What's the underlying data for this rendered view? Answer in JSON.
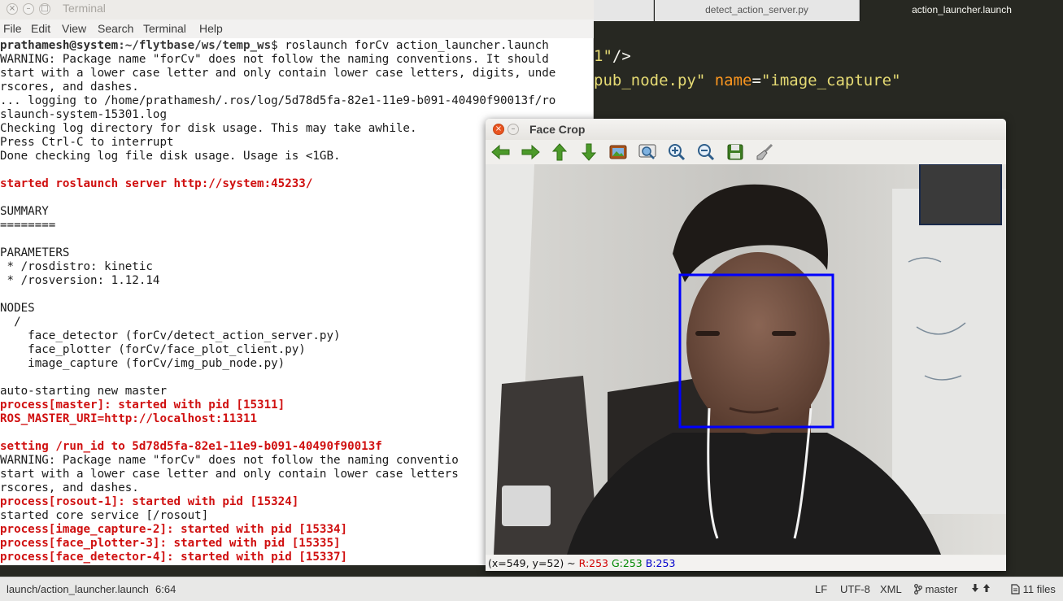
{
  "editor": {
    "tabs": [
      "detect_action_server.py",
      "action_launcher.launch"
    ],
    "active_tab": "action_launcher.launch",
    "code_line_1": {
      "str": "1\"",
      "rest": "/>"
    },
    "code_line_2": {
      "str": "pub_node.py\"",
      "attr": "name",
      "eq": "=",
      "val": "\"image_capture\""
    }
  },
  "terminal": {
    "title": "Terminal",
    "window_buttons": {
      "close": "×",
      "minimize": "–",
      "maximize": "□"
    },
    "menu": [
      "File",
      "Edit",
      "View",
      "Search",
      "Terminal",
      "Help"
    ],
    "prompt_user": "prathamesh@system",
    "prompt_path": ":~/flytbase/ws/temp_ws",
    "prompt_cmd": "$ roslaunch forCv action_launcher.launch",
    "lines": [
      {
        "text": "WARNING: Package name \"forCv\" does not follow the naming conventions. It should",
        "style": "normal"
      },
      {
        "text": "start with a lower case letter and only contain lower case letters, digits, unde",
        "style": "normal"
      },
      {
        "text": "rscores, and dashes.",
        "style": "normal"
      },
      {
        "text": "... logging to /home/prathamesh/.ros/log/5d78d5fa-82e1-11e9-b091-40490f90013f/ro",
        "style": "normal"
      },
      {
        "text": "slaunch-system-15301.log",
        "style": "normal"
      },
      {
        "text": "Checking log directory for disk usage. This may take awhile.",
        "style": "normal"
      },
      {
        "text": "Press Ctrl-C to interrupt",
        "style": "normal"
      },
      {
        "text": "Done checking log file disk usage. Usage is <1GB.",
        "style": "normal"
      },
      {
        "text": "",
        "style": "normal"
      },
      {
        "text": "started roslaunch server http://system:45233/",
        "style": "red"
      },
      {
        "text": "",
        "style": "normal"
      },
      {
        "text": "SUMMARY",
        "style": "normal"
      },
      {
        "text": "========",
        "style": "normal"
      },
      {
        "text": "",
        "style": "normal"
      },
      {
        "text": "PARAMETERS",
        "style": "normal"
      },
      {
        "text": " * /rosdistro: kinetic",
        "style": "normal"
      },
      {
        "text": " * /rosversion: 1.12.14",
        "style": "normal"
      },
      {
        "text": "",
        "style": "normal"
      },
      {
        "text": "NODES",
        "style": "normal"
      },
      {
        "text": "  /",
        "style": "normal"
      },
      {
        "text": "    face_detector (forCv/detect_action_server.py)",
        "style": "normal"
      },
      {
        "text": "    face_plotter (forCv/face_plot_client.py)",
        "style": "normal"
      },
      {
        "text": "    image_capture (forCv/img_pub_node.py)",
        "style": "normal"
      },
      {
        "text": "",
        "style": "normal"
      },
      {
        "text": "auto-starting new master",
        "style": "normal"
      },
      {
        "text": "process[master]: started with pid [15311]",
        "style": "red"
      },
      {
        "text": "ROS_MASTER_URI=http://localhost:11311",
        "style": "red"
      },
      {
        "text": "",
        "style": "normal"
      },
      {
        "text": "setting /run_id to 5d78d5fa-82e1-11e9-b091-40490f90013f",
        "style": "red"
      },
      {
        "text": "WARNING: Package name \"forCv\" does not follow the naming conventio",
        "style": "normal"
      },
      {
        "text": "start with a lower case letter and only contain lower case letters",
        "style": "normal"
      },
      {
        "text": "rscores, and dashes.",
        "style": "normal"
      },
      {
        "text": "process[rosout-1]: started with pid [15324]",
        "style": "red"
      },
      {
        "text": "started core service [/rosout]",
        "style": "normal"
      },
      {
        "text": "process[image_capture-2]: started with pid [15334]",
        "style": "red"
      },
      {
        "text": "process[face_plotter-3]: started with pid [15335]",
        "style": "red"
      },
      {
        "text": "process[face_detector-4]: started with pid [15337]",
        "style": "red"
      }
    ]
  },
  "face_crop": {
    "title": "Face Crop",
    "window_buttons": {
      "close": "×",
      "minimize": "–"
    },
    "toolbar_icons": [
      "arrow-left-icon",
      "arrow-right-icon",
      "arrow-up-icon",
      "arrow-down-icon",
      "image-icon",
      "zoom-region-icon",
      "zoom-in-icon",
      "zoom-out-icon",
      "save-icon",
      "brush-icon"
    ],
    "status": {
      "coords": "(x=549, y=52) ~ ",
      "r": "R:253",
      "g": "G:253",
      "b": "B:253"
    },
    "colors": {
      "detection_box": "#0000ff",
      "thumbnail": "#3a3a3a"
    }
  },
  "status_bar": {
    "file": "launch/action_launcher.launch",
    "position": "6:64",
    "line_ending": "LF",
    "encoding": "UTF-8",
    "grammar": "XML",
    "branch": "master",
    "files": "11 files"
  }
}
